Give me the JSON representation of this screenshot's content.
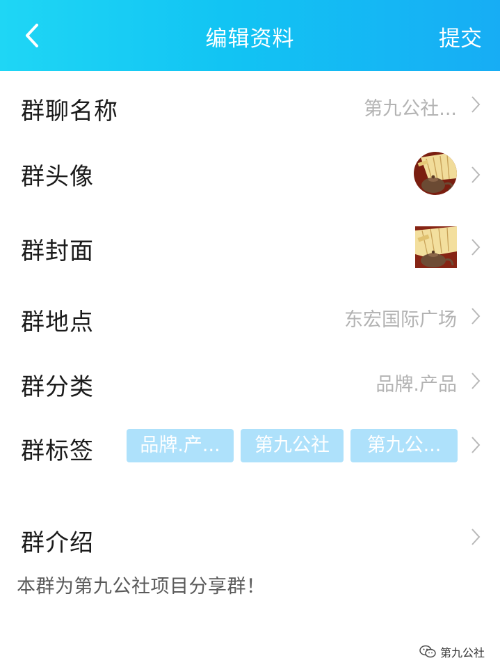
{
  "header": {
    "title": "编辑资料",
    "submit_label": "提交",
    "back_icon": "chevron-left-icon",
    "gradient": [
      "#1fd6f5",
      "#17adf4"
    ]
  },
  "rows": {
    "name": {
      "label": "群聊名称",
      "value": "第九公社..."
    },
    "avatar": {
      "label": "群头像"
    },
    "cover": {
      "label": "群封面"
    },
    "location": {
      "label": "群地点",
      "value": "东宏国际广场"
    },
    "category": {
      "label": "群分类",
      "value": "品牌.产品"
    },
    "tags": {
      "label": "群标签",
      "items": [
        "品牌.产...",
        "第九公社",
        "第九公..."
      ]
    },
    "intro": {
      "label": "群介绍",
      "text": "本群为第九公社项目分享群！"
    }
  },
  "colors": {
    "tag_bg": "#aee1fb",
    "value_text": "#b3b3b3"
  },
  "watermark": {
    "text": "第九公社",
    "icon": "wechat-icon"
  }
}
